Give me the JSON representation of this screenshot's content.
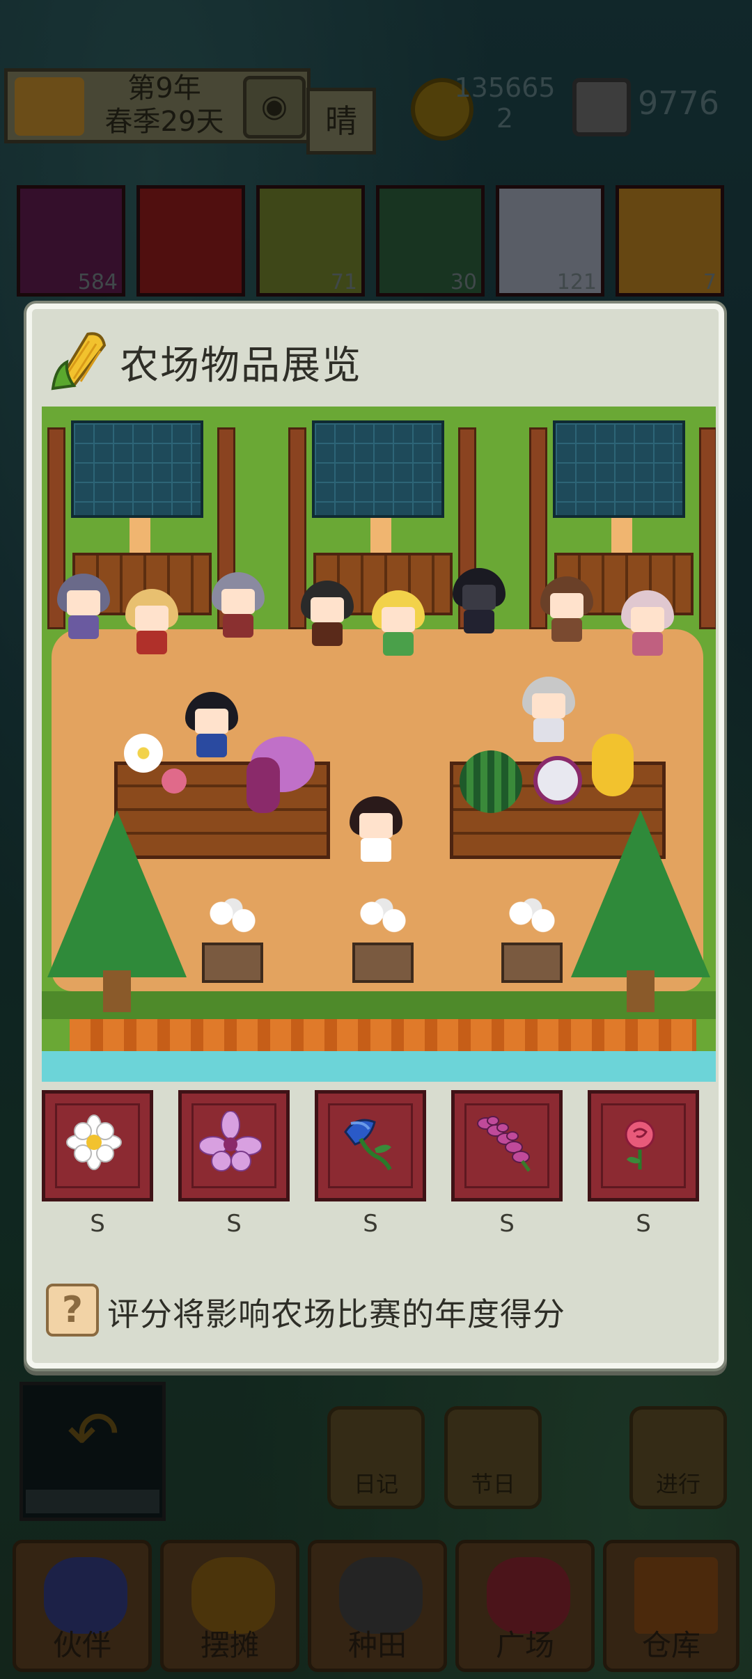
{
  "status": {
    "year": "第9年",
    "season_day": "春季29天",
    "weather": "晴",
    "coins": "135665\n2",
    "gems": "9776",
    "clock_icon": "clock-icon"
  },
  "inventory": {
    "items": [
      {
        "count": "584",
        "color": "#5a1a4a"
      },
      {
        "count": "",
        "color": "#8b1a1a"
      },
      {
        "count": "71",
        "color": "#6b7a2a"
      },
      {
        "count": "30",
        "color": "#2a5a3a"
      },
      {
        "count": "121",
        "color": "#9aa0b0"
      },
      {
        "count": "7",
        "color": "#b07a20"
      }
    ]
  },
  "modal": {
    "title": "农场物品展览",
    "icon": "corn-icon",
    "slots": [
      {
        "icon": "white-daisy-icon",
        "grade": "S"
      },
      {
        "icon": "pink-lily-icon",
        "grade": "S"
      },
      {
        "icon": "blue-bellflower-icon",
        "grade": "S"
      },
      {
        "icon": "purple-spike-flower-icon",
        "grade": "S"
      },
      {
        "icon": "pink-rose-icon",
        "grade": "S"
      }
    ],
    "hint_icon": "question-icon",
    "hint": "评分将影响农场比赛的年度得分"
  },
  "bottom": {
    "diary": "日记",
    "festival": "节日",
    "proceed": "进行",
    "nav": [
      {
        "label": "伙伴",
        "icon": "partner-icon"
      },
      {
        "label": "摆摊",
        "icon": "stall-icon"
      },
      {
        "label": "种田",
        "icon": "watering-can-icon"
      },
      {
        "label": "广场",
        "icon": "plaza-flower-icon"
      },
      {
        "label": "仓库",
        "icon": "warehouse-icon"
      }
    ]
  },
  "colors": {
    "modal_bg": "#d8dccf",
    "slot_bg": "#8c2a32",
    "title_text": "#2e2e27"
  }
}
